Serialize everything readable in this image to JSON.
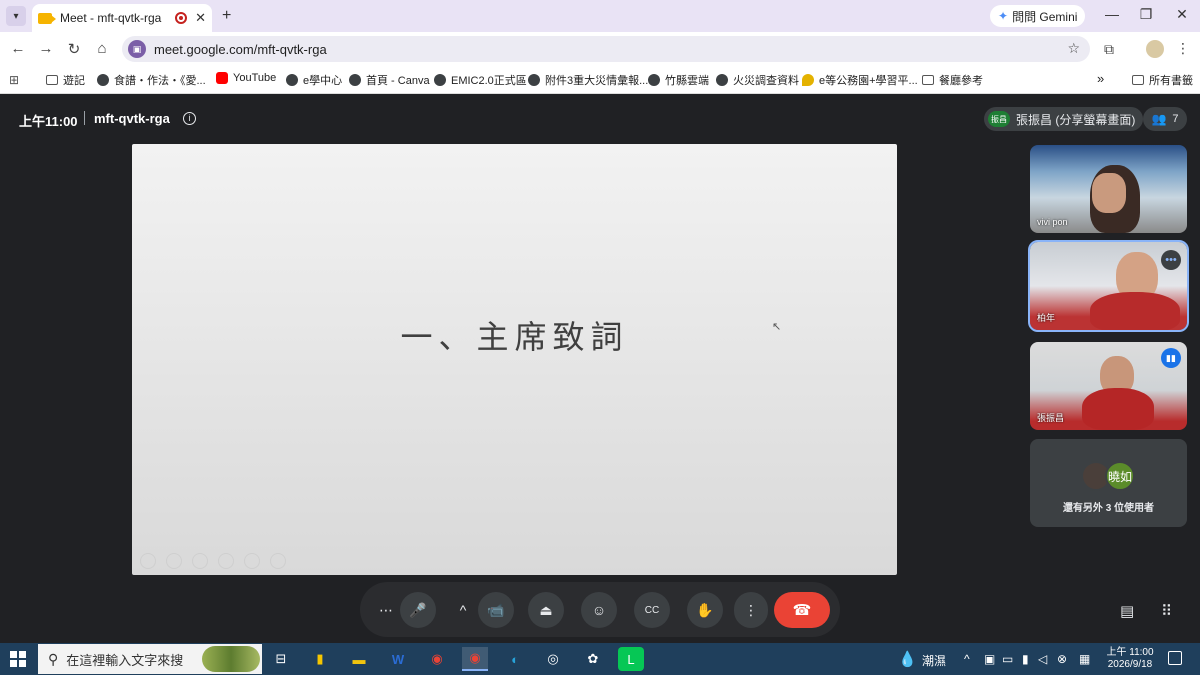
{
  "browser": {
    "tab": {
      "title": "Meet - mft-qvtk-rga",
      "close": "✕"
    },
    "new_tab": "+",
    "gemini_label": "問問 Gemini",
    "window_controls": {
      "minimize": "—",
      "restore": "❐",
      "close": "✕"
    },
    "nav": {
      "back": "←",
      "forward": "→",
      "reload": "↻",
      "home": "⌂"
    },
    "url": "meet.google.com/mft-qvtk-rga",
    "bookmark_star": "☆",
    "bookmarks": [
      {
        "label": "遊記",
        "icon": "folder"
      },
      {
        "label": "食譜・作法・《愛...",
        "icon": "globe"
      },
      {
        "label": "YouTube",
        "icon": "yt"
      },
      {
        "label": "e學中心",
        "icon": "globe"
      },
      {
        "label": "首頁 - Canva",
        "icon": "globe"
      },
      {
        "label": "EMIC2.0正式區",
        "icon": "globe"
      },
      {
        "label": "附件3重大災情彙報...",
        "icon": "globe"
      },
      {
        "label": "竹縣雲端",
        "icon": "globe"
      },
      {
        "label": "火災調查資料",
        "icon": "globe"
      },
      {
        "label": "e等公務園+學習平...",
        "icon": "pin"
      },
      {
        "label": "餐廳參考",
        "icon": "folder"
      }
    ],
    "bookmarks_overflow": "»",
    "all_bookmarks": "所有書籤"
  },
  "meet": {
    "time": "上午11:00",
    "meeting_code": "mft-qvtk-rga",
    "presenter": {
      "avatar_text": "振昌",
      "label": "張振昌 (分享螢幕畫面)"
    },
    "participant_count": "7",
    "slide": {
      "title": "一、主席致詞"
    },
    "participants": [
      {
        "name": "vivi pon"
      },
      {
        "name": "柏年"
      },
      {
        "name": "張振昌"
      }
    ],
    "others": {
      "avatar_text": "曉如",
      "label": "還有另外 3 位使用者"
    },
    "controls": {
      "more_options": "⋯",
      "mic": "🎤",
      "chevron": "^",
      "camera": "📹",
      "present": "⏏",
      "emoji": "☺",
      "captions": "CC",
      "raise_hand": "✋",
      "more": "⋮",
      "end_call": "☎"
    },
    "side": {
      "chat": "▤",
      "activities": "⠿"
    }
  },
  "taskbar": {
    "search_placeholder": "在這裡輸入文字來搜",
    "weather": "潮濕",
    "time": "上午 11:00",
    "date": "2026/9/18"
  },
  "colors": {
    "end_call": "#ea4335",
    "meet_bg": "#202124",
    "active_speaker_outline": "#8ab4f8"
  }
}
